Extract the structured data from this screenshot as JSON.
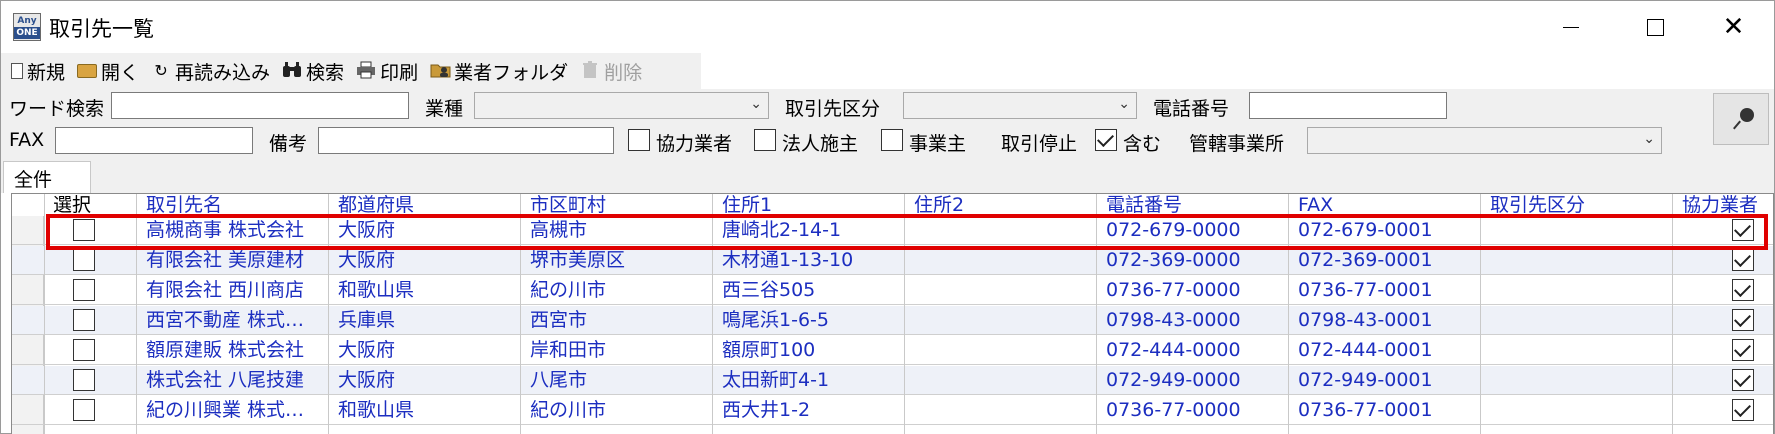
{
  "window": {
    "title": "取引先一覧",
    "app_icon_top": "Any",
    "app_icon_bottom": "ONE"
  },
  "toolbar": {
    "items": [
      {
        "label": "新規",
        "icon": "new-document-icon",
        "enabled": true
      },
      {
        "label": "開く",
        "icon": "open-folder-icon",
        "enabled": true
      },
      {
        "label": "再読み込み",
        "icon": "reload-icon",
        "enabled": true
      },
      {
        "label": "検索",
        "icon": "binoculars-icon",
        "enabled": true
      },
      {
        "label": "印刷",
        "icon": "printer-icon",
        "enabled": true
      },
      {
        "label": "業者フォルダ",
        "icon": "folder-person-icon",
        "enabled": true
      },
      {
        "label": "削除",
        "icon": "trash-icon",
        "enabled": false
      }
    ]
  },
  "filters": {
    "word_search_label": "ワード検索",
    "word_search_value": "",
    "industry_label": "業種",
    "industry_value": "",
    "partner_type_label": "取引先区分",
    "partner_type_value": "",
    "phone_label": "電話番号",
    "phone_value": "",
    "fax_label": "FAX",
    "fax_value": "",
    "memo_label": "備考",
    "memo_value": "",
    "cooperating_label": "協力業者",
    "cooperating_checked": false,
    "corporate_client_label": "法人施主",
    "corporate_client_checked": false,
    "individual_owner_label": "事業主",
    "individual_owner_checked": false,
    "suspended_label": "取引停止",
    "include_label": "含む",
    "include_checked": true,
    "office_label": "管轄事業所",
    "office_value": ""
  },
  "tabs": [
    {
      "label": "全件",
      "active": true
    }
  ],
  "grid": {
    "columns": [
      "選択",
      "取引先名",
      "都道府県",
      "市区町村",
      "住所1",
      "住所2",
      "電話番号",
      "FAX",
      "取引先区分",
      "協力業者"
    ],
    "rows": [
      {
        "selected": false,
        "name": "高槻商事 株式会社",
        "pref": "大阪府",
        "city": "高槻市",
        "addr1": "唐崎北2-14-1",
        "addr2": "",
        "tel": "072-679-0000",
        "fax": "072-679-0001",
        "type": "",
        "coop": true
      },
      {
        "selected": false,
        "name": "有限会社 美原建材",
        "pref": "大阪府",
        "city": "堺市美原区",
        "addr1": "木材通1-13-10",
        "addr2": "",
        "tel": "072-369-0000",
        "fax": "072-369-0001",
        "type": "",
        "coop": true
      },
      {
        "selected": false,
        "name": "有限会社 西川商店",
        "pref": "和歌山県",
        "city": "紀の川市",
        "addr1": "西三谷505",
        "addr2": "",
        "tel": "0736-77-0000",
        "fax": "0736-77-0001",
        "type": "",
        "coop": true
      },
      {
        "selected": false,
        "name": "西宮不動産 株式…",
        "pref": "兵庫県",
        "city": "西宮市",
        "addr1": "鳴尾浜1-6-5",
        "addr2": "",
        "tel": "0798-43-0000",
        "fax": "0798-43-0001",
        "type": "",
        "coop": true
      },
      {
        "selected": false,
        "name": "額原建販 株式会社",
        "pref": "大阪府",
        "city": "岸和田市",
        "addr1": "額原町100",
        "addr2": "",
        "tel": "072-444-0000",
        "fax": "072-444-0001",
        "type": "",
        "coop": true
      },
      {
        "selected": false,
        "name": "株式会社 八尾技建",
        "pref": "大阪府",
        "city": "八尾市",
        "addr1": "太田新町4-1",
        "addr2": "",
        "tel": "072-949-0000",
        "fax": "072-949-0001",
        "type": "",
        "coop": true
      },
      {
        "selected": false,
        "name": "紀の川興業 株式…",
        "pref": "和歌山県",
        "city": "紀の川市",
        "addr1": "西大井1-2",
        "addr2": "",
        "tel": "0736-77-0000",
        "fax": "0736-77-0001",
        "type": "",
        "coop": true
      }
    ]
  },
  "colors": {
    "link_text": "#1c2ec0",
    "highlight_border": "#e00000",
    "alt_row": "#eef1f8"
  }
}
